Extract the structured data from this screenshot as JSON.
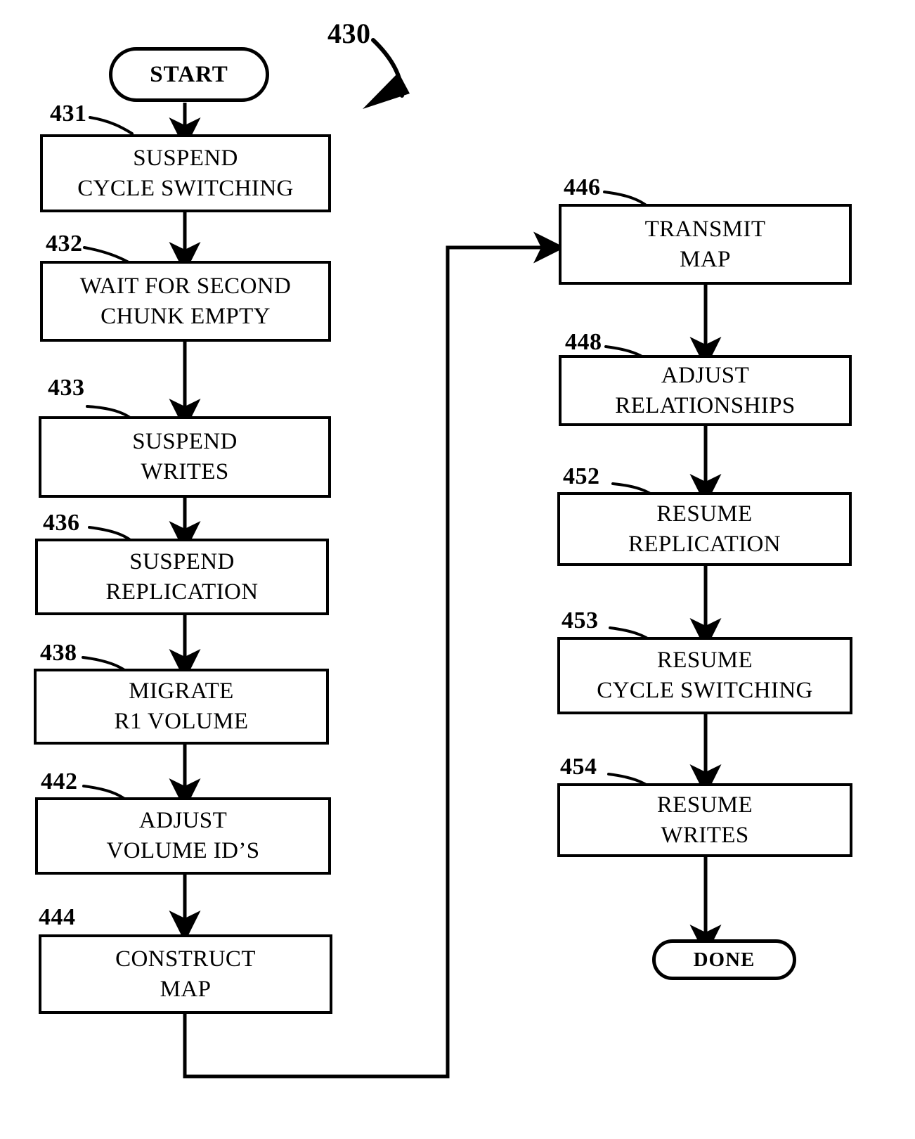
{
  "figure": {
    "number": "430",
    "terminals": {
      "start": "START",
      "done": "DONE"
    },
    "nodes": [
      {
        "ref": "431",
        "lines": [
          "SUSPEND",
          "CYCLE SWITCHING"
        ]
      },
      {
        "ref": "432",
        "lines": [
          "WAIT FOR SECOND",
          "CHUNK EMPTY"
        ]
      },
      {
        "ref": "433",
        "lines": [
          "SUSPEND",
          "WRITES"
        ]
      },
      {
        "ref": "436",
        "lines": [
          "SUSPEND",
          "REPLICATION"
        ]
      },
      {
        "ref": "438",
        "lines": [
          "MIGRATE",
          "R1 VOLUME"
        ]
      },
      {
        "ref": "442",
        "lines": [
          "ADJUST",
          "VOLUME ID’S"
        ]
      },
      {
        "ref": "444",
        "lines": [
          "CONSTRUCT",
          "MAP"
        ]
      },
      {
        "ref": "446",
        "lines": [
          "TRANSMIT",
          "MAP"
        ]
      },
      {
        "ref": "448",
        "lines": [
          "ADJUST",
          "RELATIONSHIPS"
        ]
      },
      {
        "ref": "452",
        "lines": [
          "RESUME",
          "REPLICATION"
        ]
      },
      {
        "ref": "453",
        "lines": [
          "RESUME",
          "CYCLE SWITCHING"
        ]
      },
      {
        "ref": "454",
        "lines": [
          "RESUME",
          "WRITES"
        ]
      }
    ],
    "colors": {
      "ink": "#000000",
      "paper": "#ffffff"
    }
  }
}
